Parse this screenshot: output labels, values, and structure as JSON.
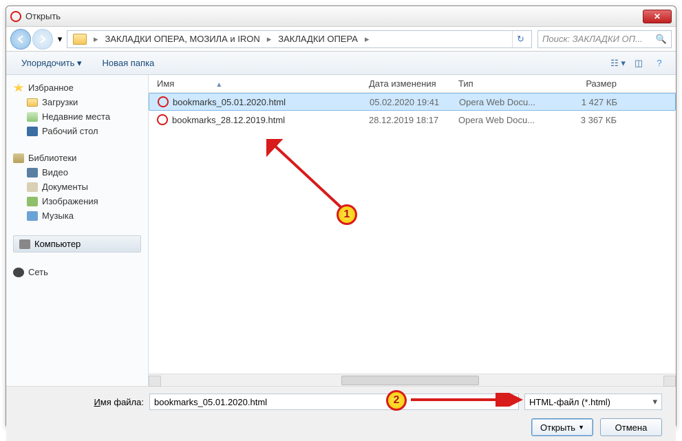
{
  "window": {
    "title": "Открыть"
  },
  "breadcrumb": {
    "items": [
      "ЗАКЛАДКИ ОПЕРА,  МОЗИЛА и IRON",
      "ЗАКЛАДКИ ОПЕРА"
    ]
  },
  "search": {
    "placeholder": "Поиск: ЗАКЛАДКИ ОП..."
  },
  "toolbar": {
    "organize": "Упорядочить",
    "newfolder": "Новая папка"
  },
  "sidebar": {
    "favorites": {
      "label": "Избранное",
      "items": [
        "Загрузки",
        "Недавние места",
        "Рабочий стол"
      ]
    },
    "libraries": {
      "label": "Библиотеки",
      "items": [
        "Видео",
        "Документы",
        "Изображения",
        "Музыка"
      ]
    },
    "computer": "Компьютер",
    "network": "Сеть"
  },
  "columns": {
    "name": "Имя",
    "date": "Дата изменения",
    "type": "Тип",
    "size": "Размер"
  },
  "files": [
    {
      "name": "bookmarks_05.01.2020.html",
      "date": "05.02.2020 19:41",
      "type": "Opera Web Docu...",
      "size": "1 427 КБ",
      "selected": true
    },
    {
      "name": "bookmarks_28.12.2019.html",
      "date": "28.12.2019 18:17",
      "type": "Opera Web Docu...",
      "size": "3 367 КБ",
      "selected": false
    }
  ],
  "footer": {
    "filename_label": "Имя файла:",
    "filename_value": "bookmarks_05.01.2020.html",
    "filter": "HTML-файл (*.html)",
    "open": "Открыть",
    "cancel": "Отмена"
  },
  "annotations": {
    "badge1": "1",
    "badge2": "2"
  }
}
